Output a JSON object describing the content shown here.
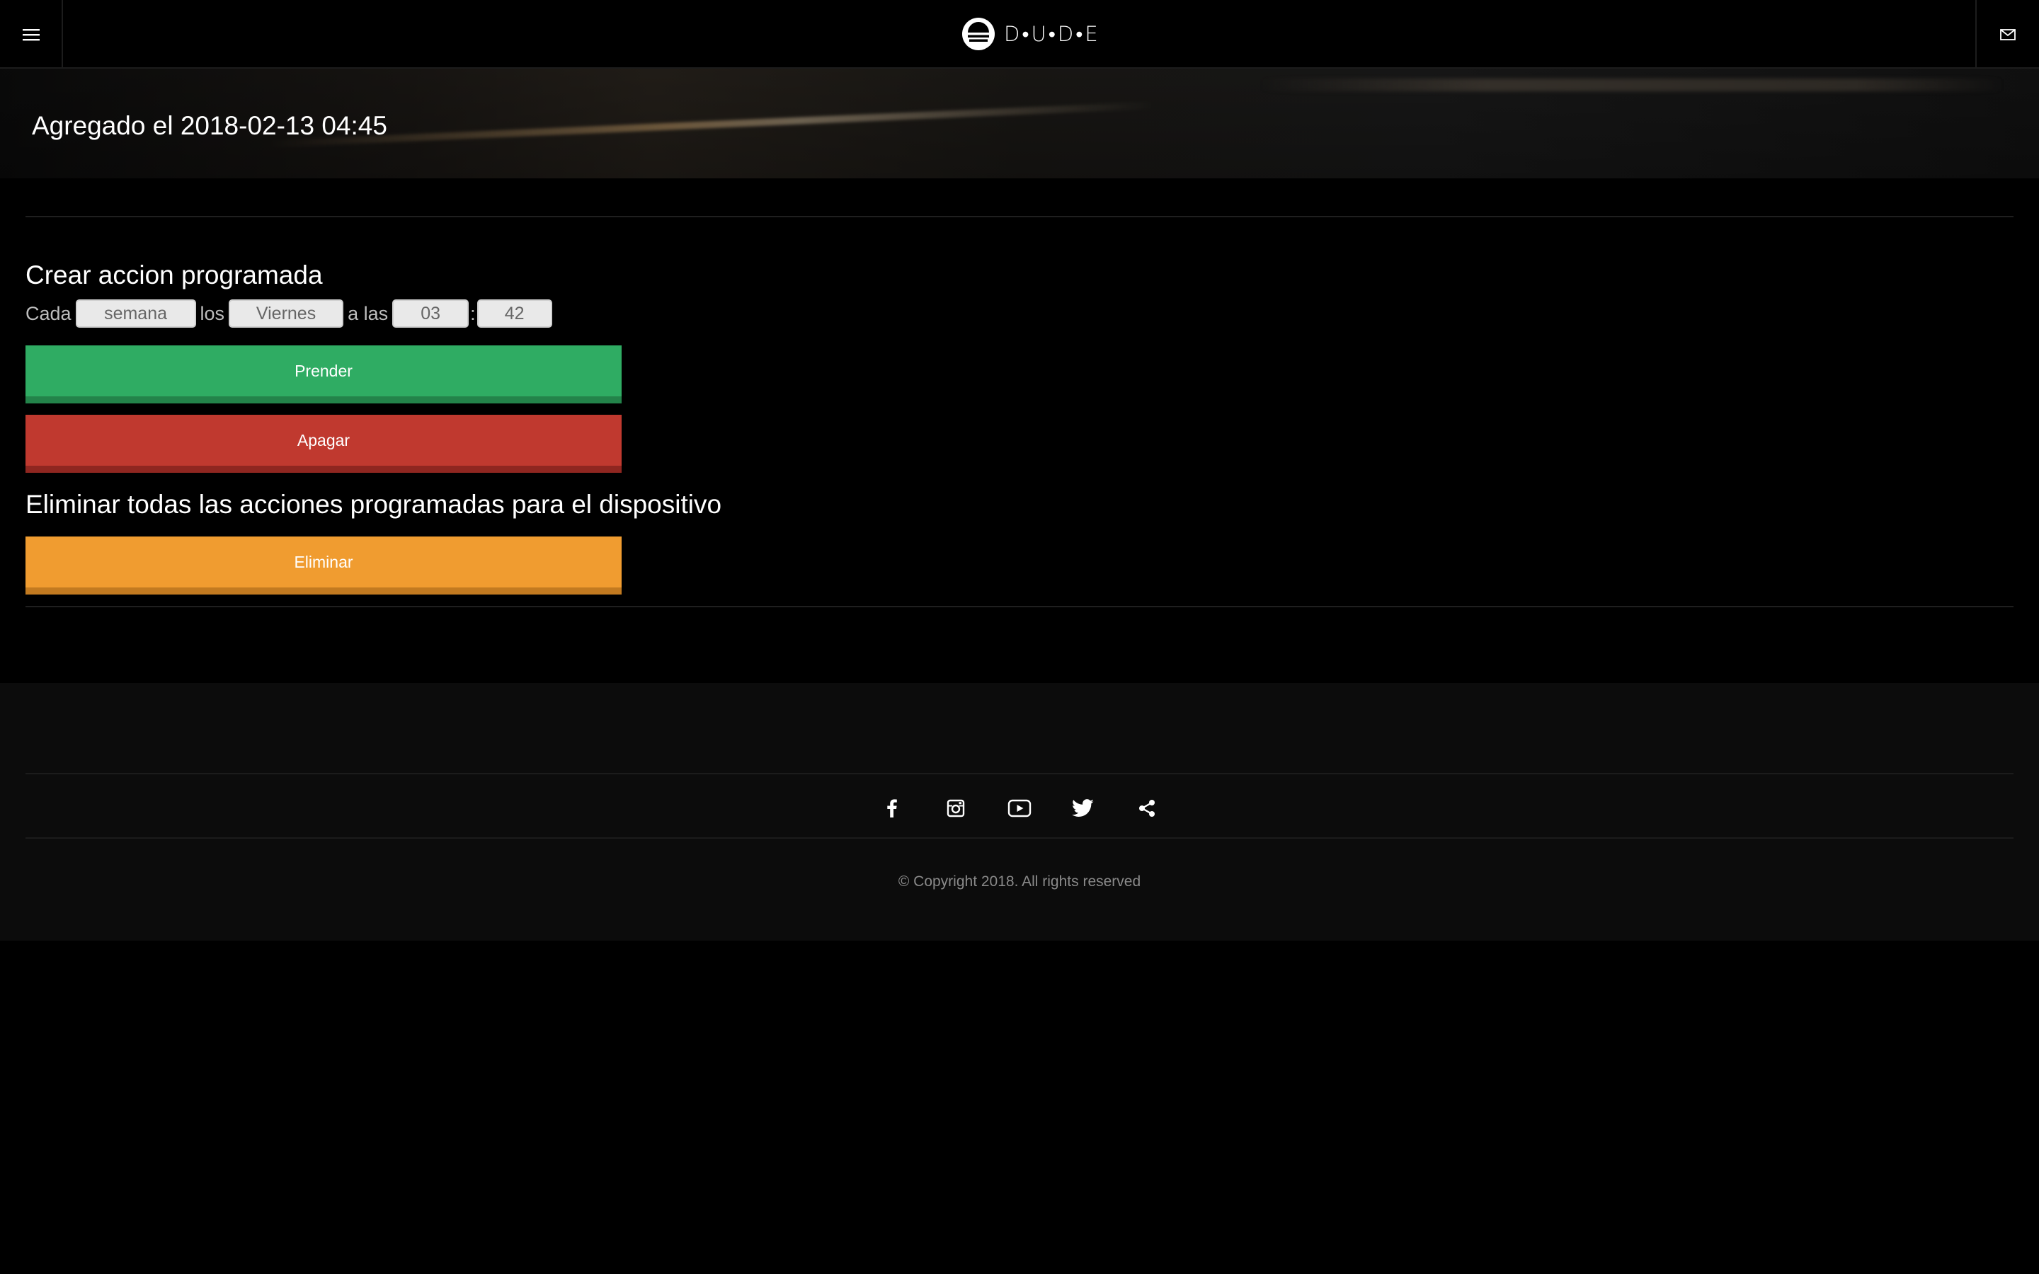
{
  "header": {
    "menu_icon": "hamburger-menu-icon",
    "logo_text": "D•U•D•E",
    "mail_icon": "mail-icon"
  },
  "hero": {
    "title": "Agregado el 2018-02-13 04:45"
  },
  "schedule": {
    "heading": "Crear accion programada",
    "label_every": "Cada",
    "period": "semana",
    "label_on": "los",
    "day": "Viernes",
    "label_at": "a las",
    "hour": "03",
    "separator": ":",
    "minute": "42",
    "on_button": "Prender",
    "off_button": "Apagar"
  },
  "delete_all": {
    "heading": "Eliminar todas las acciones programadas para el dispositivo",
    "button": "Eliminar"
  },
  "footer": {
    "socials": [
      "facebook-icon",
      "instagram-icon",
      "youtube-icon",
      "twitter-icon",
      "share-icon"
    ],
    "copyright": "© Copyright 2018. All rights reserved"
  },
  "colors": {
    "background": "#000000",
    "on_button": "#2fac63",
    "off_button": "#c0392f",
    "delete_button": "#f09c30",
    "footer_bg": "#0c0c0c"
  }
}
